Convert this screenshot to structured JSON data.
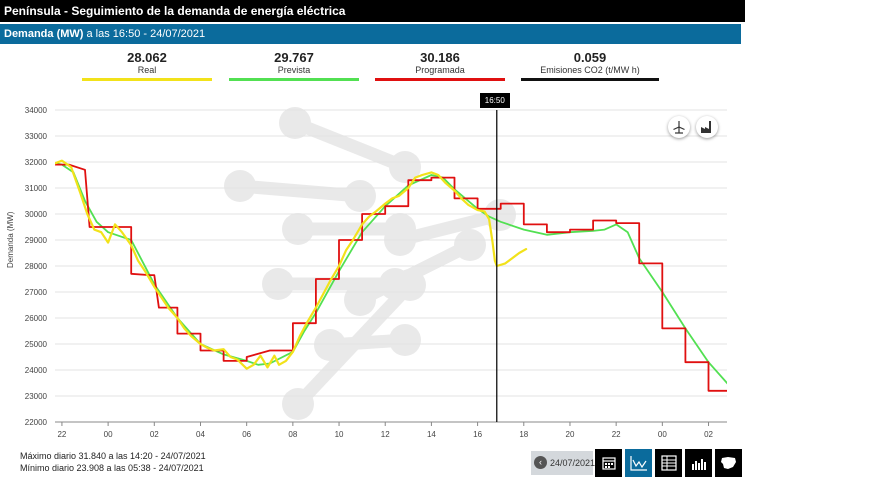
{
  "header": {
    "title": "Península  -  Seguimiento de la demanda de energía eléctrica",
    "subtitle_bold": "Demanda (MW)",
    "subtitle_rest": " a las 16:50 - 24/07/2021"
  },
  "stats": [
    {
      "value": "28.062",
      "label": "Real",
      "color": "#f2e21a"
    },
    {
      "value": "29.767",
      "label": "Prevista",
      "color": "#52e052"
    },
    {
      "value": "30.186",
      "label": "Programada",
      "color": "#e01010"
    },
    {
      "value": "0.059",
      "label": "Emisiones CO2 (t/MW h)",
      "color": "#111111"
    }
  ],
  "cursor": {
    "label": "16:50"
  },
  "footer": {
    "max_text": "Máximo diario 31.840 a las 14:20 - 24/07/2021",
    "min_text": "Mínimo diario 23.908 a las 05:38 - 24/07/2021",
    "date": "24/07/2021"
  },
  "toolbar": {
    "icons": [
      "calendar-icon",
      "chart-icon",
      "table-icon",
      "bar-chart-icon",
      "spain-map-icon"
    ],
    "active": "chart-icon"
  },
  "chart_data": {
    "type": "line",
    "ylabel": "Demanda (MW)",
    "ylim": [
      22000,
      34000
    ],
    "yticks": [
      22000,
      23000,
      24000,
      25000,
      26000,
      27000,
      28000,
      29000,
      30000,
      31000,
      32000,
      33000,
      34000
    ],
    "ytick_labels": [
      "22000",
      "23000",
      "24000",
      "25000",
      "26000",
      "27000",
      "28000",
      "29000",
      "30000",
      "31000",
      "32000",
      "33000",
      "34000"
    ],
    "xlim": [
      -2.3,
      26.8
    ],
    "xticks": [
      -2,
      0,
      2,
      4,
      6,
      8,
      10,
      12,
      14,
      16,
      18,
      20,
      22,
      24,
      26
    ],
    "xtick_labels": [
      "22",
      "00",
      "02",
      "04",
      "06",
      "08",
      "10",
      "12",
      "14",
      "16",
      "18",
      "20",
      "22",
      "00",
      "02"
    ],
    "cursor_x": 16.83,
    "colors": {
      "real": "#f2e21a",
      "prevista": "#52e052",
      "programada": "#e01010"
    },
    "series": [
      {
        "key": "real",
        "points": [
          [
            -3,
            31900
          ],
          [
            -2.7,
            32000
          ],
          [
            -2.3,
            31950
          ],
          [
            -2,
            32050
          ],
          [
            -1.6,
            31800
          ],
          [
            -1.2,
            30800
          ],
          [
            -0.9,
            30000
          ],
          [
            -0.6,
            29400
          ],
          [
            -0.3,
            29300
          ],
          [
            0,
            28900
          ],
          [
            0.3,
            29600
          ],
          [
            0.6,
            29300
          ],
          [
            1,
            28800
          ],
          [
            1.3,
            28200
          ],
          [
            1.6,
            27800
          ],
          [
            2,
            27200
          ],
          [
            2.3,
            26800
          ],
          [
            2.6,
            26400
          ],
          [
            3,
            26000
          ],
          [
            3.3,
            25600
          ],
          [
            3.6,
            25300
          ],
          [
            4,
            25000
          ],
          [
            4.3,
            24850
          ],
          [
            4.6,
            24750
          ],
          [
            5,
            24800
          ],
          [
            5.3,
            24500
          ],
          [
            5.6,
            24400
          ],
          [
            6,
            24050
          ],
          [
            6.3,
            24200
          ],
          [
            6.6,
            24550
          ],
          [
            6.9,
            24100
          ],
          [
            7.2,
            24550
          ],
          [
            7.4,
            24200
          ],
          [
            7.7,
            24350
          ],
          [
            8,
            24700
          ],
          [
            8.3,
            25300
          ],
          [
            8.6,
            25800
          ],
          [
            9,
            26400
          ],
          [
            9.3,
            26900
          ],
          [
            9.6,
            27400
          ],
          [
            10,
            28000
          ],
          [
            10.3,
            28600
          ],
          [
            10.6,
            29000
          ],
          [
            11,
            29600
          ],
          [
            11.3,
            29900
          ],
          [
            11.6,
            30100
          ],
          [
            12,
            30400
          ],
          [
            12.3,
            30600
          ],
          [
            12.6,
            30700
          ],
          [
            13,
            31000
          ],
          [
            13.3,
            31400
          ],
          [
            13.6,
            31500
          ],
          [
            14,
            31600
          ],
          [
            14.3,
            31500
          ],
          [
            14.6,
            31200
          ],
          [
            15,
            30900
          ],
          [
            15.3,
            30600
          ],
          [
            15.6,
            30350
          ],
          [
            16,
            30150
          ],
          [
            16.3,
            30100
          ],
          [
            16.5,
            29800
          ],
          [
            16.65,
            28900
          ],
          [
            16.75,
            28200
          ],
          [
            16.83,
            28000
          ],
          [
            17.2,
            28100
          ],
          [
            17.5,
            28300
          ],
          [
            17.8,
            28500
          ],
          [
            18.1,
            28650
          ]
        ]
      },
      {
        "key": "prevista",
        "points": [
          [
            -3,
            32100
          ],
          [
            -2,
            31900
          ],
          [
            -1.5,
            31600
          ],
          [
            -1,
            30500
          ],
          [
            -0.5,
            29700
          ],
          [
            0,
            29300
          ],
          [
            1,
            29000
          ],
          [
            2,
            27300
          ],
          [
            3,
            26000
          ],
          [
            4,
            25000
          ],
          [
            5,
            24600
          ],
          [
            6,
            24350
          ],
          [
            6.5,
            24200
          ],
          [
            7,
            24250
          ],
          [
            8,
            24700
          ],
          [
            8.5,
            25500
          ],
          [
            9,
            26200
          ],
          [
            10,
            27800
          ],
          [
            11,
            29300
          ],
          [
            12,
            30300
          ],
          [
            13,
            31100
          ],
          [
            14,
            31500
          ],
          [
            14.5,
            31400
          ],
          [
            15,
            30950
          ],
          [
            16,
            30200
          ],
          [
            16.5,
            29900
          ],
          [
            17,
            29700
          ],
          [
            18,
            29400
          ],
          [
            19,
            29200
          ],
          [
            20,
            29300
          ],
          [
            21,
            29350
          ],
          [
            21.5,
            29400
          ],
          [
            22,
            29600
          ],
          [
            22.5,
            29300
          ],
          [
            23,
            28300
          ],
          [
            24,
            27000
          ],
          [
            25,
            25600
          ],
          [
            26,
            24300
          ],
          [
            27,
            23300
          ]
        ]
      },
      {
        "key": "programada",
        "step": true,
        "points": [
          [
            -2.3,
            31900
          ],
          [
            -1.7,
            31900
          ],
          [
            -1,
            31700
          ],
          [
            -0.8,
            29500
          ],
          [
            0,
            29500
          ],
          [
            1,
            29500
          ],
          [
            1,
            28500
          ],
          [
            1.0,
            27700
          ],
          [
            1.8,
            27650
          ],
          [
            2,
            27650
          ],
          [
            2.2,
            26400
          ],
          [
            3,
            26400
          ],
          [
            3,
            25400
          ],
          [
            4,
            25400
          ],
          [
            4,
            24750
          ],
          [
            5,
            24750
          ],
          [
            5,
            24350
          ],
          [
            6,
            24350
          ],
          [
            6,
            24500
          ],
          [
            7,
            24750
          ],
          [
            8,
            24750
          ],
          [
            8,
            25800
          ],
          [
            9,
            25800
          ],
          [
            9,
            27500
          ],
          [
            10,
            27500
          ],
          [
            10,
            29000
          ],
          [
            11,
            29000
          ],
          [
            11,
            30000
          ],
          [
            12,
            30000
          ],
          [
            12,
            30300
          ],
          [
            13,
            30300
          ],
          [
            13,
            31300
          ],
          [
            14,
            31300
          ],
          [
            14,
            31400
          ],
          [
            15,
            31400
          ],
          [
            15,
            30600
          ],
          [
            16,
            30600
          ],
          [
            16,
            30200
          ],
          [
            17,
            30200
          ],
          [
            17,
            30400
          ],
          [
            18,
            30400
          ],
          [
            18,
            29600
          ],
          [
            19,
            29600
          ],
          [
            19,
            29300
          ],
          [
            20,
            29300
          ],
          [
            20,
            29400
          ],
          [
            21,
            29400
          ],
          [
            21,
            29750
          ],
          [
            22,
            29750
          ],
          [
            22,
            29650
          ],
          [
            23,
            29650
          ],
          [
            23,
            28100
          ],
          [
            24,
            28100
          ],
          [
            24,
            25600
          ],
          [
            25,
            25600
          ],
          [
            25,
            24300
          ],
          [
            26,
            24300
          ],
          [
            26,
            23200
          ],
          [
            26.8,
            23200
          ]
        ]
      }
    ]
  }
}
